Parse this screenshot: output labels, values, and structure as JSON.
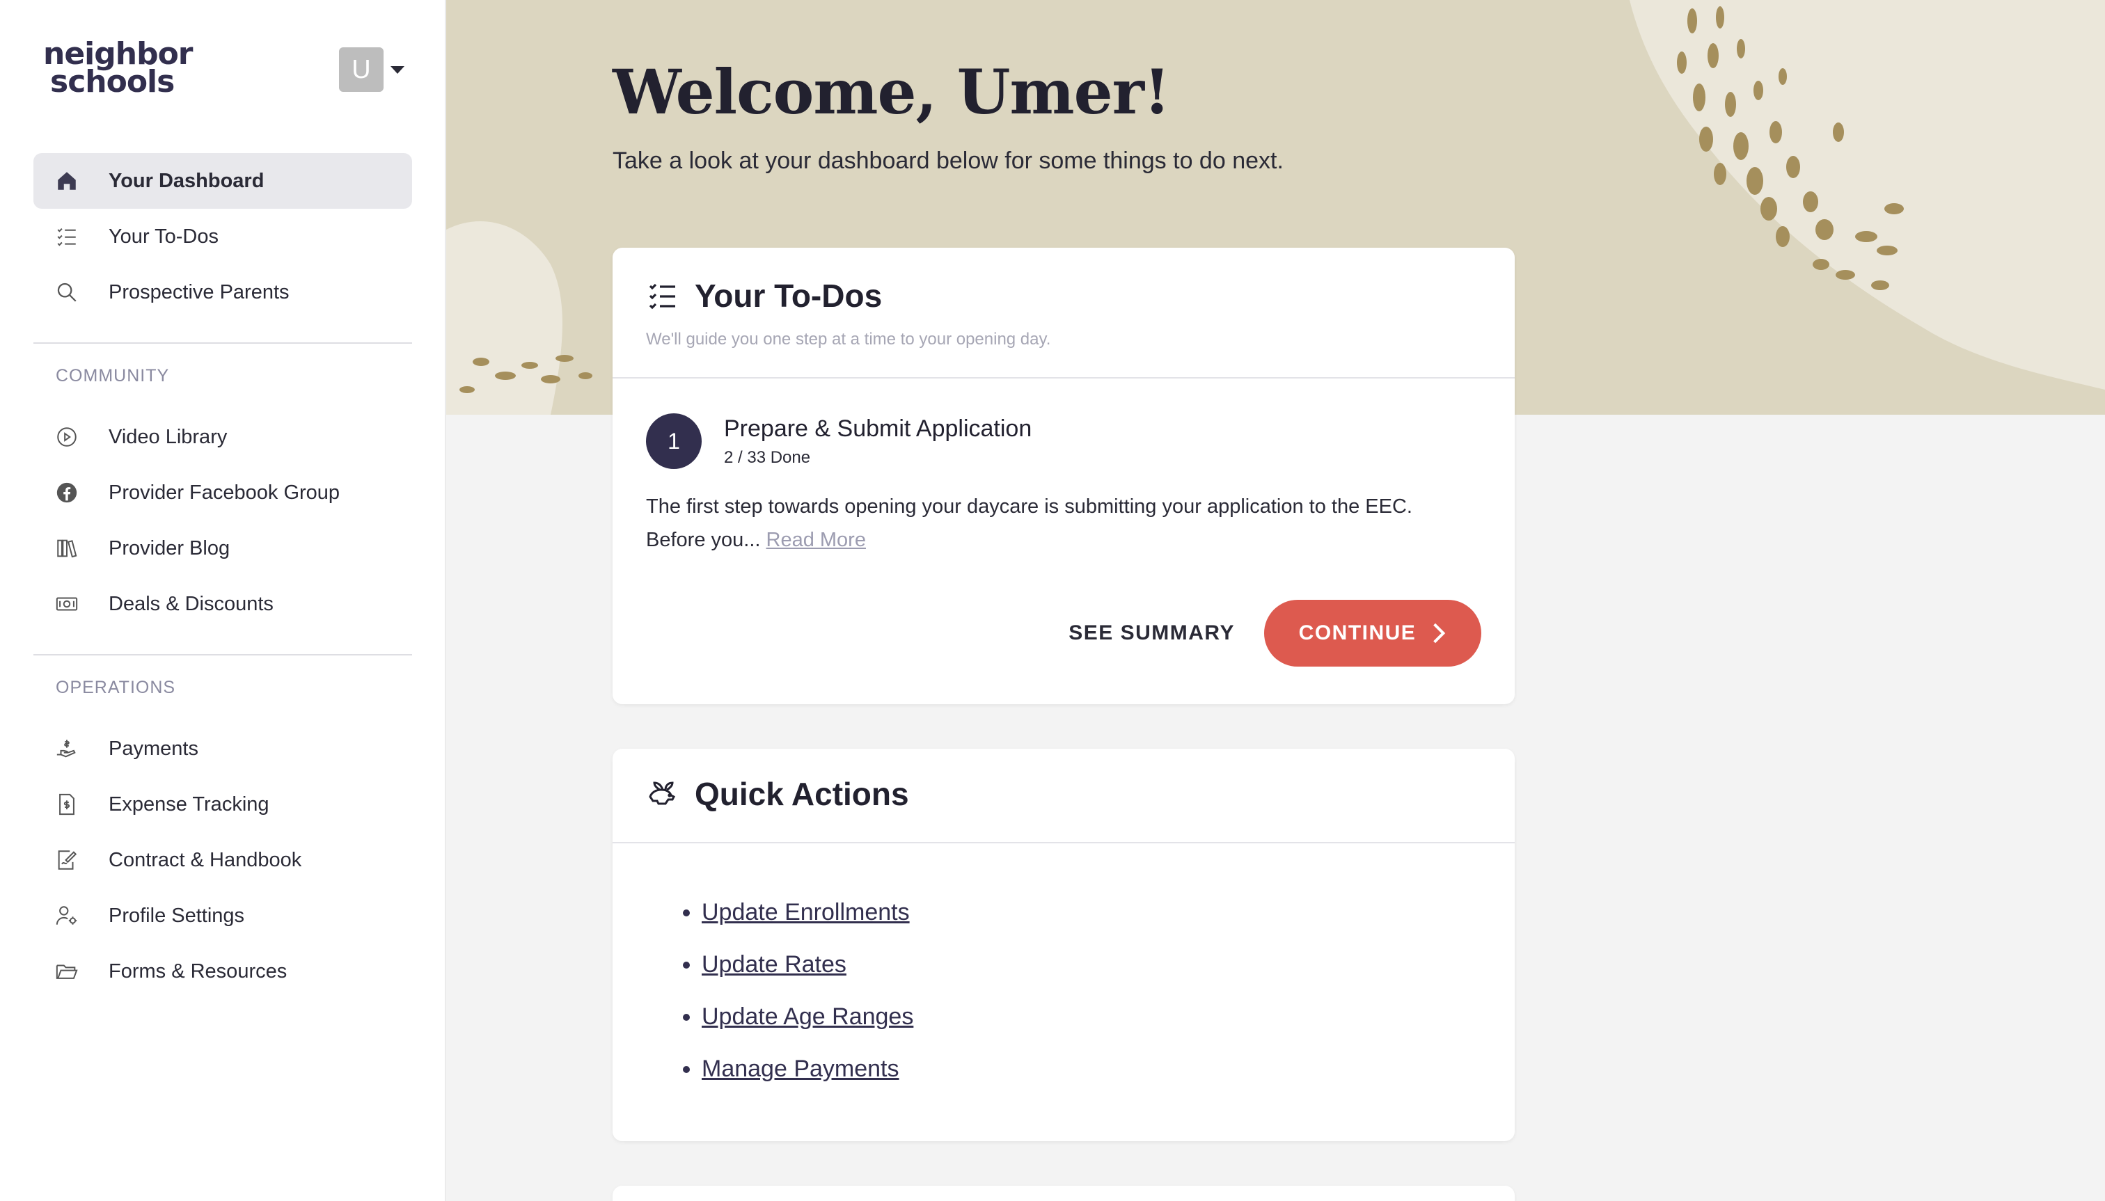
{
  "brand": {
    "logo_line1": "neighbor",
    "logo_line2": "schools",
    "primary": "#322f4e",
    "accent": "#dd5a4f",
    "hero_bg": "#dcd6c0"
  },
  "user": {
    "avatar_initial": "U"
  },
  "sidebar": {
    "main_items": [
      {
        "label": "Your Dashboard",
        "icon": "home-icon",
        "active": true
      },
      {
        "label": "Your To-Dos",
        "icon": "checklist-icon"
      },
      {
        "label": "Prospective Parents",
        "icon": "search-icon"
      }
    ],
    "community_label": "COMMUNITY",
    "community_items": [
      {
        "label": "Video Library",
        "icon": "play-circle-icon"
      },
      {
        "label": "Provider Facebook Group",
        "icon": "facebook-icon"
      },
      {
        "label": "Provider Blog",
        "icon": "books-icon"
      },
      {
        "label": "Deals & Discounts",
        "icon": "money-icon"
      }
    ],
    "operations_label": "OPERATIONS",
    "operations_items": [
      {
        "label": "Payments",
        "icon": "hand-dollar-icon"
      },
      {
        "label": "Expense Tracking",
        "icon": "receipt-dollar-icon"
      },
      {
        "label": "Contract & Handbook",
        "icon": "document-sign-icon"
      },
      {
        "label": "Profile Settings",
        "icon": "user-settings-icon"
      },
      {
        "label": "Forms & Resources",
        "icon": "folder-icon"
      }
    ]
  },
  "header": {
    "title": "Welcome, Umer!",
    "subtitle": "Take a look at your dashboard below for some things to do next."
  },
  "todos": {
    "title": "Your To-Dos",
    "subtitle": "We'll guide you one step at a time to your opening day.",
    "step_number": "1",
    "step_title": "Prepare & Submit Application",
    "step_progress": "2 / 33 Done",
    "description_line1": "The first step towards opening your daycare is submitting your application to the EEC.",
    "description_line2": "Before you...",
    "read_more": "Read More",
    "see_summary": "SEE SUMMARY",
    "continue": "CONTINUE"
  },
  "quick_actions": {
    "title": "Quick Actions",
    "links": [
      "Update Enrollments",
      "Update Rates",
      "Update Age Ranges",
      "Manage Payments"
    ]
  }
}
